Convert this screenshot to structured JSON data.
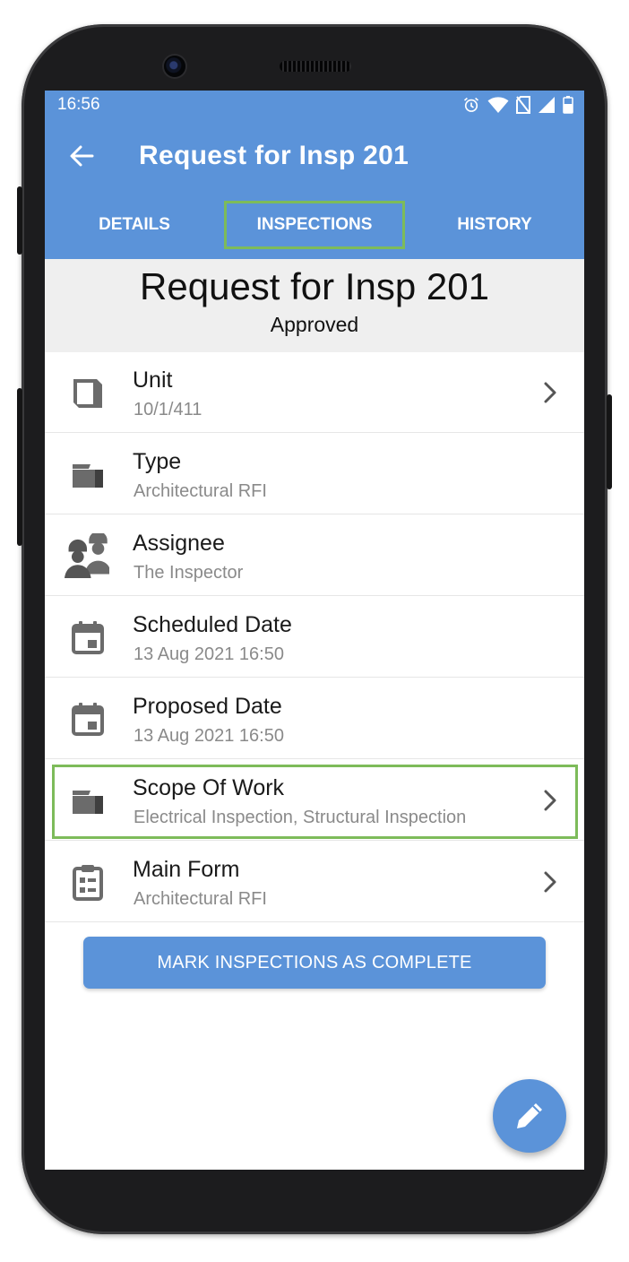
{
  "status_bar": {
    "time": "16:56",
    "icons": [
      "alarm-icon",
      "wifi-icon",
      "no-sim-icon",
      "signal-icon",
      "battery-icon"
    ]
  },
  "app_bar": {
    "back_icon": "back-arrow-icon",
    "title": "Request for Insp 201"
  },
  "tabs": [
    {
      "label": "DETAILS",
      "active": false
    },
    {
      "label": "INSPECTIONS",
      "active": true,
      "highlighted": true
    },
    {
      "label": "HISTORY",
      "active": false
    }
  ],
  "header": {
    "title": "Request for Insp 201",
    "status": "Approved"
  },
  "fields": [
    {
      "label": "Unit",
      "value": "10/1/411",
      "icon": "cube-icon",
      "has_chevron": true
    },
    {
      "label": "Type",
      "value": "Architectural RFI",
      "icon": "folder-icon",
      "has_chevron": false
    },
    {
      "label": "Assignee",
      "value": "The Inspector",
      "icon": "workers-icon",
      "has_chevron": false
    },
    {
      "label": "Scheduled Date",
      "value": "13 Aug 2021 16:50",
      "icon": "calendar-icon",
      "has_chevron": false
    },
    {
      "label": "Proposed Date",
      "value": "13 Aug 2021 16:50",
      "icon": "calendar-icon",
      "has_chevron": false
    },
    {
      "label": "Scope Of Work",
      "value": "Electrical Inspection, Structural Inspection",
      "icon": "folder-icon",
      "has_chevron": true,
      "highlighted": true
    },
    {
      "label": "Main Form",
      "value": "Architectural RFI",
      "icon": "clipboard-icon",
      "has_chevron": true
    }
  ],
  "actions": {
    "complete_button": "MARK INSPECTIONS AS COMPLETE",
    "fab_icon": "pencil-icon"
  },
  "colors": {
    "primary": "#5b93d9",
    "highlight": "#7dbb5a",
    "header_band": "#efefef",
    "secondary_text": "#8a8a8a"
  }
}
